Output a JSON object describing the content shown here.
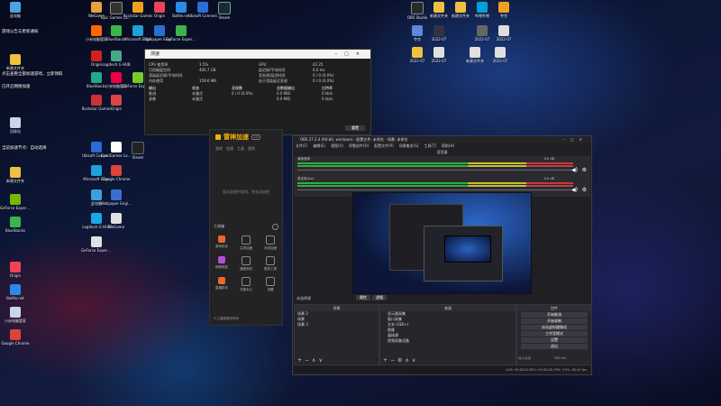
{
  "desktop_icons": [
    {
      "label": "此电脑",
      "color": "#4ea3e0"
    },
    {
      "label": "WeGame",
      "color": "#e6a23c"
    },
    {
      "label": "Epic Games Launcher",
      "color": "#333"
    },
    {
      "label": "Rockstar Games",
      "color": "#f0a020"
    },
    {
      "label": "Origin",
      "color": "#e45"
    },
    {
      "label": "Battle.net",
      "color": "#2b8ae6"
    },
    {
      "label": "Ubisoft Connect",
      "color": "#2c6cd8"
    },
    {
      "label": "Steam",
      "color": "#1b2838"
    },
    {
      "label": "回收站",
      "color": "#c8d6e8"
    },
    {
      "label": "BlueStacks",
      "color": "#3cb44b"
    },
    {
      "label": "小米电脑管家",
      "color": "#f60"
    },
    {
      "label": "Microsoft Edge",
      "color": "#1fa0d8"
    },
    {
      "label": "Google Chrome",
      "color": "#db4437"
    },
    {
      "label": "GeForce Experience",
      "color": "#76b900"
    },
    {
      "label": "Logitech G HUB",
      "color": "#1aa8e0"
    },
    {
      "label": "Wallpaper Engine",
      "color": "#3a6fd0"
    }
  ],
  "desktop_icons_right": [
    {
      "label": "OBS Studio",
      "color": "#2a2a2a"
    },
    {
      "label": "新建文件夹",
      "color": "#f0c040"
    },
    {
      "label": "哔哩哔哩",
      "color": "#00a1d6"
    },
    {
      "label": "夸克",
      "color": "#4a8cff"
    },
    {
      "label": "2022-07",
      "color": "#e0e0e0"
    }
  ],
  "speed_window": {
    "title": "测速",
    "rows": [
      {
        "c1": "CPU 使用率",
        "c2": "3.5%",
        "c3": "GPU",
        "c4": "42.25"
      },
      {
        "c1": "可用磁盘空间",
        "c2": "400.7 GB",
        "c3": "延迟帧/平均时间",
        "c4": "0.0 ms"
      },
      {
        "c1": "渲染延迟帧/平均时间",
        "c2": "",
        "c3": "丢失帧/延迟时间",
        "c4": "0 / 0 (0.0%)"
      },
      {
        "c1": "内存使用",
        "c2": "159.6 MB",
        "c3": "由于渲染延迟丢帧",
        "c4": "0 / 0 (0.0%)"
      }
    ],
    "table_header": [
      "输出",
      "状态",
      "丢帧数",
      "总数据输出",
      "比特率"
    ],
    "table_rows": [
      [
        "推流",
        "未激活",
        "0 / 0 (0.0%)",
        "0.0 MiB",
        "0 kb/s"
      ],
      [
        "录像",
        "未激活",
        "",
        "0.0 MiB",
        "0 kb/s"
      ]
    ],
    "button": "重置"
  },
  "leigod": {
    "logo": "雷神加速",
    "version": "1.0",
    "tabs": [
      "游戏",
      "加速",
      "工具",
      "我的"
    ],
    "empty_hint": "暂无加速中游戏，快去添加吧",
    "tools_title": "工具箱",
    "tools": [
      {
        "label": "游戏优化",
        "color": "#e86a2c"
      },
      {
        "label": "主机加速",
        "color": "#888"
      },
      {
        "label": "手游加速",
        "color": "#888"
      },
      {
        "label": "网络修复",
        "color": "#b04fd8"
      },
      {
        "label": "速度测试",
        "color": "#888"
      },
      {
        "label": "更多工具",
        "color": "#888"
      },
      {
        "label": "直播助手",
        "color": "#e86a2c"
      },
      {
        "label": "兑换中心",
        "color": "#888"
      },
      {
        "label": "设置",
        "color": "#888"
      }
    ],
    "footer": "人工客服服务时间"
  },
  "obs": {
    "title": "OBS 27.2.4 (64-bit, windows) - 配置文件: 未命名 - 场景: 未命名",
    "menu": [
      "文件(F)",
      "编辑(E)",
      "视图(V)",
      "停靠部件(D)",
      "配置文件(P)",
      "场景集合(S)",
      "工具(T)",
      "帮助(H)"
    ],
    "mixer_title": "混音器",
    "tracks": [
      {
        "name": "桌面音频",
        "db": "0.0 dB"
      },
      {
        "name": "麦克风/Aux",
        "db": "0.0 dB"
      }
    ],
    "source_label": "未选择源",
    "props_btn": "属性",
    "filters_btn": "滤镜",
    "scenes_title": "场景",
    "scenes": [
      "场景 2",
      "场景",
      "场景 3"
    ],
    "sources_title": "来源",
    "sources": [
      "显示器采集",
      "窗口采集",
      "文本 (GDI+)",
      "图像",
      "媒体源",
      "视频采集设备"
    ],
    "controls_title": "控件",
    "controls": [
      "开始推流",
      "开始录制",
      "启动虚拟摄像机",
      "工作室模式",
      "设置",
      "退出"
    ],
    "transition_label": "淡入淡出",
    "transition_duration": "300 ms",
    "status": "LIVE: 00:00:00   REC: 00:00:00   CPU: 3.5%, 60.00 fps"
  },
  "notices": [
    "游戏公告与更新通知",
    "点击查看全部加速游戏，立即领取",
    "已开启网络加速",
    "当前加速节点：自动选择"
  ]
}
